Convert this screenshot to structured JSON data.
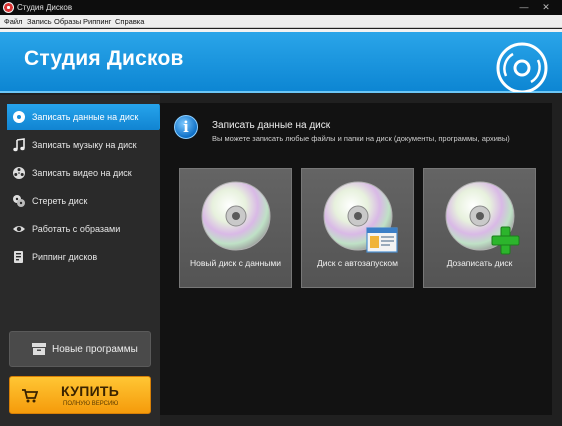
{
  "window": {
    "title": "Студия Дисков",
    "minimize": "—",
    "close": "✕"
  },
  "menu": [
    "Файл",
    "Запись",
    "Образы",
    "Риппинг",
    "Справка"
  ],
  "banner": {
    "brand": "Студия Дисков"
  },
  "sidebar": {
    "items": [
      {
        "label": "Записать данные на диск",
        "icon": "disc-icon",
        "active": true
      },
      {
        "label": "Записать музыку на диск",
        "icon": "music-note-icon",
        "active": false
      },
      {
        "label": "Записать видео на диск",
        "icon": "film-reel-icon",
        "active": false
      },
      {
        "label": "Стереть диск",
        "icon": "erase-discs-icon",
        "active": false
      },
      {
        "label": "Работать с образами",
        "icon": "eye-icon",
        "active": false
      },
      {
        "label": "Риппинг дисков",
        "icon": "rip-icon",
        "active": false
      }
    ],
    "new_programs_label": "Новые программы",
    "buy": {
      "main": "КУПИТЬ",
      "sub": "ПОЛНУЮ ВЕРСИЮ"
    }
  },
  "main": {
    "heading": "Записать данные на диск",
    "subheading": "Вы можете записать любые файлы и папки на диск (документы, программы, архивы)",
    "tiles": [
      {
        "label": "Новый диск с данными",
        "badge": "none"
      },
      {
        "label": "Диск с автозапуском",
        "badge": "window"
      },
      {
        "label": "Дозаписать диск",
        "badge": "plus"
      }
    ]
  },
  "colors": {
    "accent": "#1a94e0",
    "buy": "#f7a817",
    "plus": "#2cb52c"
  }
}
